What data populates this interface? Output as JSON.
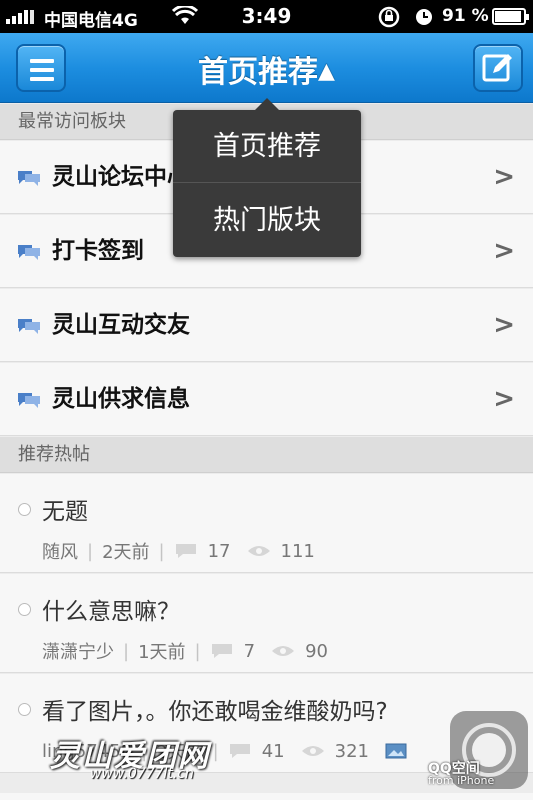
{
  "status_bar": {
    "carrier": "中国电信4G",
    "time": "3:49",
    "battery": "91 %"
  },
  "nav": {
    "title": "首页推荐",
    "caret": "▲"
  },
  "dropdown": {
    "items": [
      "首页推荐",
      "热门版块"
    ]
  },
  "sections": {
    "frequent": "最常访问板块",
    "hot": "推荐热帖"
  },
  "boards": [
    {
      "label": "灵山论坛中心"
    },
    {
      "label": "打卡签到"
    },
    {
      "label": "灵山互动交友"
    },
    {
      "label": "灵山供求信息"
    }
  ],
  "posts": [
    {
      "title": "无题",
      "author": "随风",
      "time": "2天前",
      "comments": "17",
      "views": "111",
      "has_image": false
    },
    {
      "title": "什么意思嘛？",
      "author": "潇潇宁少",
      "time": "1天前",
      "comments": "7",
      "views": "90",
      "has_image": false
    },
    {
      "title": "看了图片，。你还敢喝金维酸奶吗?",
      "author": "ling57458",
      "time": "2天前",
      "comments": "41",
      "views": "321",
      "has_image": true
    }
  ],
  "overlay": {
    "watermark": "灵山爱团网",
    "watermark_url": "www.0777lt.cn",
    "qq_brand": "QQ空间",
    "qq_sub": "from iPhone"
  },
  "icons": {
    "menu": "hamburger-icon",
    "compose": "compose-icon",
    "board": "chat-bubbles-icon",
    "chevron": "chevron-right-icon",
    "comments": "comment-icon",
    "views": "eye-icon",
    "image": "image-icon"
  },
  "colors": {
    "nav_blue": "#1d8ee0",
    "popover_bg": "#3a3a3a",
    "section_bg": "#dedede"
  }
}
